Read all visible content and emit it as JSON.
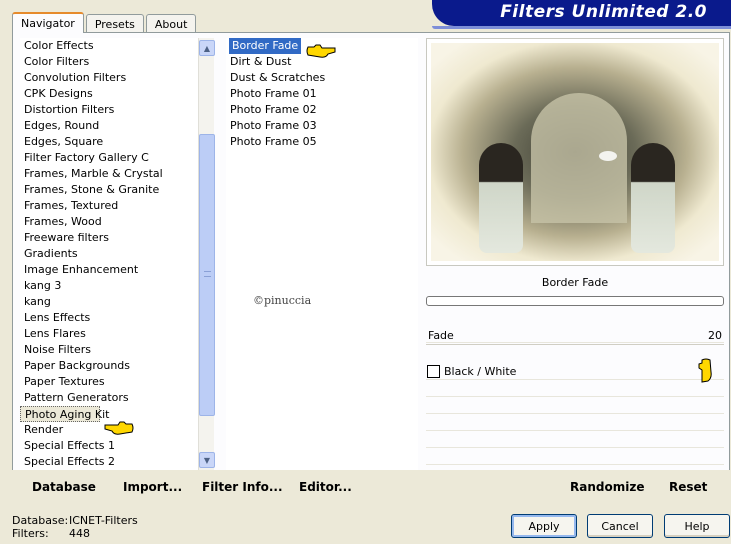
{
  "tabs": [
    "Navigator",
    "Presets",
    "About"
  ],
  "app_title": "Filters Unlimited 2.0",
  "categories": [
    "Color Effects",
    "Color Filters",
    "Convolution Filters",
    "CPK Designs",
    "Distortion Filters",
    "Edges, Round",
    "Edges, Square",
    "Filter Factory Gallery C",
    "Frames, Marble & Crystal",
    "Frames, Stone & Granite",
    "Frames, Textured",
    "Frames, Wood",
    "Freeware filters",
    "Gradients",
    "Image Enhancement",
    "kang 3",
    "kang",
    "Lens Effects",
    "Lens Flares",
    "Noise Filters",
    "Paper Backgrounds",
    "Paper Textures",
    "Pattern Generators",
    "Photo Aging Kit",
    "Render",
    "Special Effects 1",
    "Special Effects 2"
  ],
  "selected_category": "Photo Aging Kit",
  "filters": [
    "Border Fade",
    "Dirt & Dust",
    "Dust & Scratches",
    "Photo Frame 01",
    "Photo Frame 02",
    "Photo Frame 03",
    "Photo Frame 05"
  ],
  "selected_filter": "Border Fade",
  "watermark": "©pinuccia",
  "params": {
    "title": "Border Fade",
    "fade_label": "Fade",
    "fade_value": "20",
    "checkbox_label": "Black / White"
  },
  "bottom_buttons": {
    "database": "Database",
    "import": "Import...",
    "filter_info": "Filter Info...",
    "editor": "Editor...",
    "randomize": "Randomize",
    "reset": "Reset"
  },
  "status": {
    "database_label": "Database:",
    "database_value": "ICNET-Filters",
    "filters_label": "Filters:",
    "filters_value": "448"
  },
  "dialog_buttons": {
    "apply": "Apply",
    "cancel": "Cancel",
    "help": "Help"
  },
  "colors": {
    "title_bg": "#0a1a8c",
    "selection": "#316ac5",
    "tab_accent": "#e68b2c"
  }
}
